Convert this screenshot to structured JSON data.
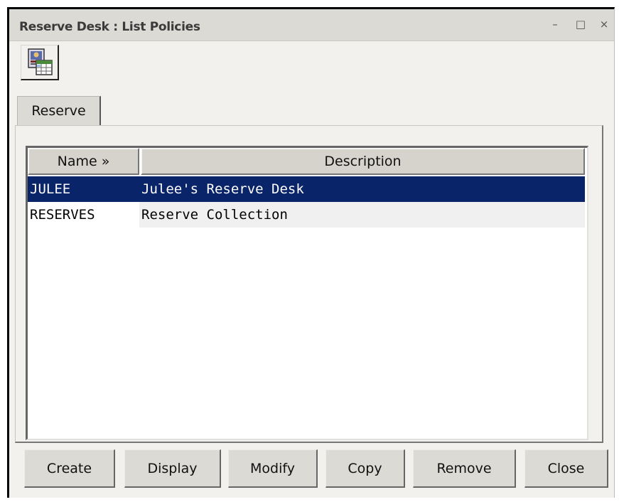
{
  "window": {
    "title": "Reserve Desk : List Policies",
    "controls": {
      "minimize": "–",
      "maximize": "□",
      "close": "×"
    }
  },
  "toolbar": {
    "icon": "policy-table-icon"
  },
  "tabs": [
    {
      "label": "Reserve",
      "active": true
    }
  ],
  "table": {
    "columns": [
      {
        "label": "Name »"
      },
      {
        "label": "Description"
      }
    ],
    "rows": [
      {
        "name": "JULEE",
        "description": "Julee's Reserve Desk",
        "selected": true
      },
      {
        "name": "RESERVES",
        "description": "Reserve Collection",
        "selected": false
      }
    ]
  },
  "buttons": {
    "create": "Create",
    "display": "Display",
    "modify": "Modify",
    "copy": "Copy",
    "remove": "Remove",
    "close": "Close"
  },
  "colors": {
    "selection": "#0a246a",
    "window_bg": "#f2f1ee",
    "title_bg": "#dcdad4"
  }
}
